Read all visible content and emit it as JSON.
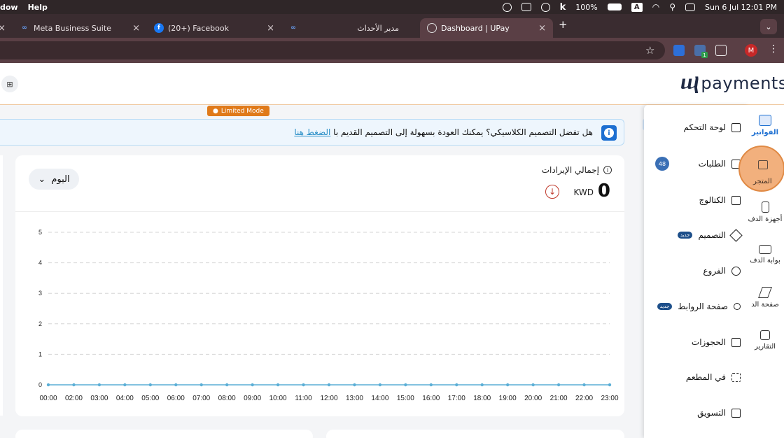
{
  "menubar": {
    "left_items": [
      "dow",
      "Help"
    ],
    "battery": "100%",
    "input_source": "A",
    "datetime": "Sun 6 Jul  12:01 PM"
  },
  "tabs": [
    {
      "label": "Meta Business Suite",
      "favicon": "meta-icon"
    },
    {
      "label": "(20+) Facebook",
      "favicon": "facebook-icon"
    },
    {
      "label": "مدير الأحداث",
      "favicon": "meta-icon"
    },
    {
      "label": "Dashboard | UPay",
      "favicon": "upay-icon",
      "active": true
    }
  ],
  "profile_initial": "M",
  "extension_badge": "1",
  "app": {
    "logo_text": "payments",
    "limited_mode": "Limited Mode",
    "banner": {
      "text": "هل تفضل التصميم الكلاسيكي؟ يمكنك العودة بسهولة إلى التصميم القديم با ",
      "link": "الضغط هنا"
    },
    "revenue": {
      "title": "إجمالي الإيرادات",
      "amount": "0",
      "currency": "KWD",
      "period": "اليوم"
    }
  },
  "chart_data": {
    "type": "line",
    "x": [
      "00:00",
      "02:00",
      "03:00",
      "04:00",
      "05:00",
      "06:00",
      "07:00",
      "08:00",
      "09:00",
      "10:00",
      "11:00",
      "12:00",
      "13:00",
      "14:00",
      "15:00",
      "16:00",
      "17:00",
      "18:00",
      "19:00",
      "20:00",
      "21:00",
      "22:00",
      "23:00"
    ],
    "series": [
      {
        "values": [
          0,
          0,
          0,
          0,
          0,
          0,
          0,
          0,
          0,
          0,
          0,
          0,
          0,
          0,
          0,
          0,
          0,
          0,
          0,
          0,
          0,
          0,
          0
        ]
      }
    ],
    "ylim": [
      0,
      5
    ],
    "yticks": [
      0,
      1,
      2,
      3,
      4,
      5
    ],
    "grid": true,
    "color": "#5aaed6"
  },
  "iconbar": [
    {
      "label": "الفواتير",
      "icon": "invoice-icon"
    },
    {
      "label": "المتجر",
      "icon": "store-icon"
    },
    {
      "label": "أجهزة الدف",
      "icon": "device-icon"
    },
    {
      "label": "بوابة الدف",
      "icon": "card-icon"
    },
    {
      "label": "صفحة الد",
      "icon": "send-icon"
    },
    {
      "label": "التقارير",
      "icon": "report-icon"
    }
  ],
  "menu": [
    {
      "label": "لوحة التحكم",
      "icon": "grid-icon"
    },
    {
      "label": "الطلبات",
      "icon": "clipboard-icon",
      "count": "48"
    },
    {
      "label": "الكتالوج",
      "icon": "catalog-icon"
    },
    {
      "label": "التصميم",
      "icon": "design-icon",
      "badge": "جديد"
    },
    {
      "label": "الفروع",
      "icon": "branch-icon"
    },
    {
      "label": "صفحة الروابط",
      "icon": "link-icon",
      "badge": "جديد"
    },
    {
      "label": "الحجوزات",
      "icon": "calendar-icon"
    },
    {
      "label": "في المطعم",
      "icon": "qr-icon"
    },
    {
      "label": "التسويق",
      "icon": "megaphone-icon"
    }
  ]
}
